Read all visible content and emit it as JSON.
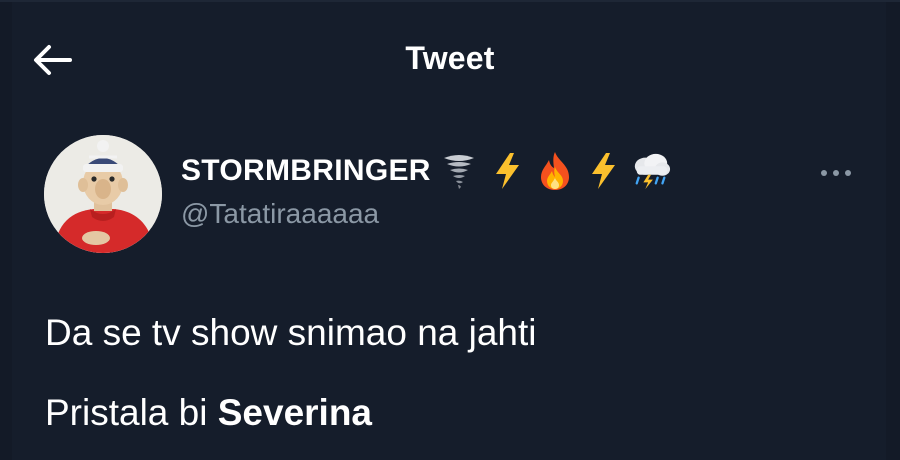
{
  "header": {
    "title": "Tweet",
    "back_icon": "arrow-left-icon"
  },
  "tweet": {
    "author": {
      "display_name": "STORMBRINGER",
      "name_emojis": [
        "tornado-icon",
        "lightning-icon",
        "fire-icon",
        "lightning-icon",
        "thunderstorm-cloud-icon"
      ],
      "handle": "@Tatatiraaaaaa",
      "avatar": "avatar-puppet-red-sweater"
    },
    "more_icon": "more-dots-icon",
    "text": {
      "line1": "Da se tv show snimao na jahti",
      "line2_regular": "Pristala bi ",
      "line2_bold": "Severina"
    }
  },
  "colors": {
    "background": "#151d2b",
    "text_primary": "#ffffff",
    "text_secondary": "#8b98a5"
  }
}
